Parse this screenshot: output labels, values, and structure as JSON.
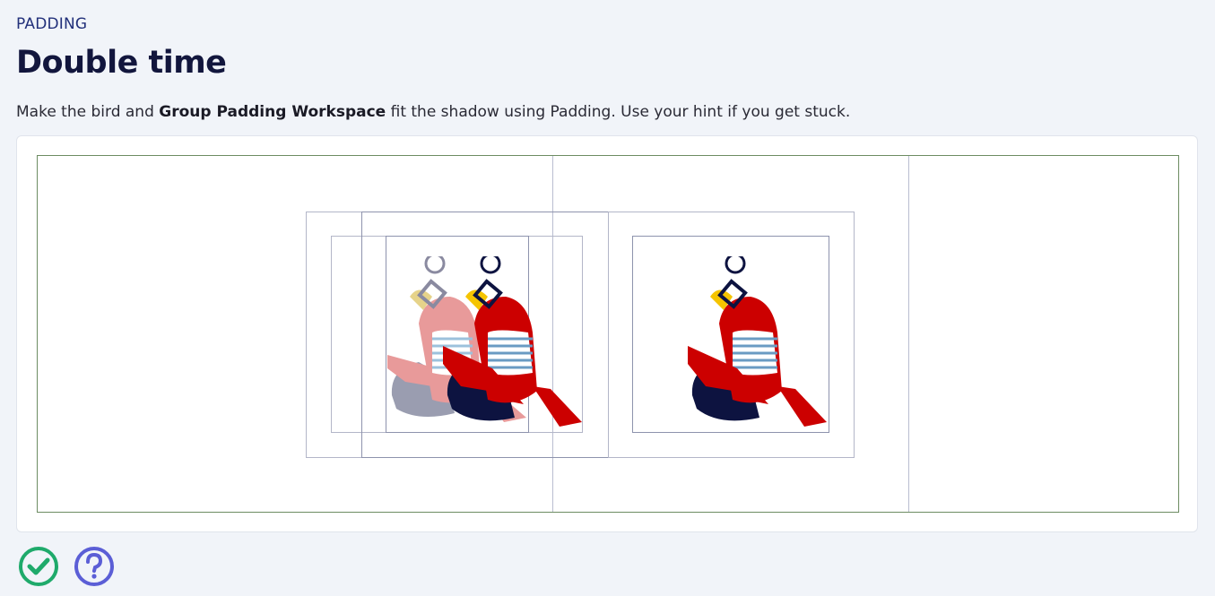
{
  "header": {
    "eyebrow": "PADDING",
    "title": "Double time",
    "instruction_pre": "Make the bird and ",
    "instruction_bold": "Group Padding Workspace",
    "instruction_post": " fit the shadow using Padding. Use your hint if you get stuck."
  },
  "workspace": {
    "label": "Group Padding Workspace"
  },
  "actions": {
    "check_icon": "check-circle-icon",
    "hint_icon": "question-circle-icon"
  },
  "colors": {
    "background": "#f1f4f9",
    "bird_red": "#cc0000",
    "bird_shadow_pink": "#e89a9a",
    "bird_shadow_grey": "#9a9db0",
    "beak": "#f5c400",
    "stripes": "#6a9bc3",
    "check_green": "#1faa6b",
    "hint_purple": "#5b5ed6"
  }
}
